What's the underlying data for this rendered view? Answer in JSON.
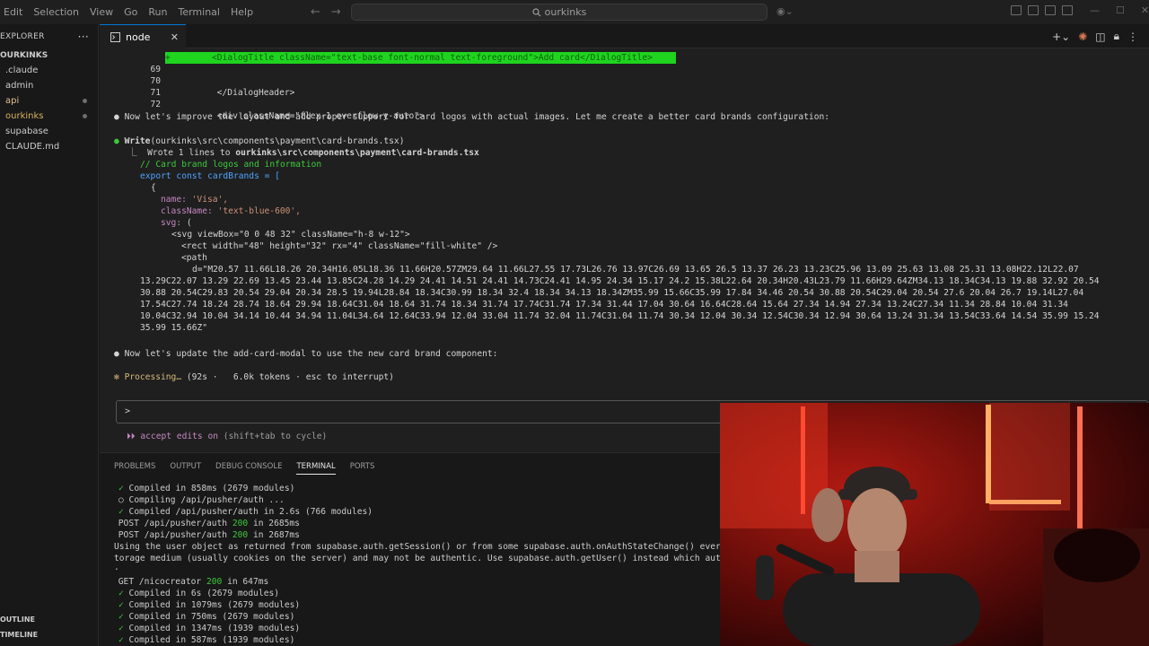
{
  "menu": [
    "Edit",
    "Selection",
    "View",
    "Go",
    "Run",
    "Terminal",
    "Help"
  ],
  "search": {
    "label": "ourkinks"
  },
  "sidebar": {
    "header": "EXPLORER",
    "root": "OURKINKS",
    "items": [
      ".claude",
      "admin",
      "api",
      "ourkinks",
      "supabase",
      "CLAUDE.md"
    ],
    "outline": "OUTLINE",
    "timeline": "TIMELINE"
  },
  "tab": {
    "label": "node",
    "close": "✕"
  },
  "code": {
    "l69_num": "69",
    "l69_prefix": "+",
    "l69_text": "        <DialogTitle className=\"text-base font-normal text-foreground\">Add card</DialogTitle>",
    "l70_num": "70",
    "l70_text": "          </DialogHeader>",
    "l71_num": "71",
    "l72_num": "72",
    "l72_text": "          <div className=\"flex-1 overflow-y-auto\">"
  },
  "messages": {
    "m1": "Now let's improve the layout and add proper support for card logos with actual images. Let me create a better card brands configuration:",
    "write_call": "Write",
    "write_arg": "(ourkinks\\src\\components\\payment\\card-brands.tsx)",
    "wrote_prefix": "⎿  Wrote 1 lines to ",
    "wrote_path": "ourkinks\\src\\components\\payment\\card-brands.tsx",
    "c1": "// Card brand logos and information",
    "c2": "export const cardBrands = [",
    "c3": "{",
    "c4_key": "name: ",
    "c4_val": "'Visa',",
    "c5_key": "className: ",
    "c5_val": "'text-blue-600',",
    "c6_key": "svg: ",
    "c6_val": "(",
    "c7": "<svg viewBox=\"0 0 48 32\" className=\"h-8 w-12\">",
    "c8": "<rect width=\"48\" height=\"32\" rx=\"4\" className=\"fill-white\" />",
    "c9": "<path",
    "c10": "d=\"M20.57 11.66L18.26 20.34H16.05L18.36 11.66H20.57ZM29.64 11.66L27.55 17.73L26.76 13.97C26.69 13.65 26.5 13.37 26.23 13.23C25.96 13.09 25.63 13.08 25.31 13.08H22.12L22.07",
    "c11": "13.29C22.07 13.29 22.69 13.45 23.44 13.85C24.28 14.29 24.41 14.51 24.41 14.73C24.41 14.95 24.34 15.17 24.2 15.38L22.64 20.34H20.43L23.79 11.66H29.64ZM34.13 18.34C34.13 19.88 32.92 20.54",
    "c12": "30.88 20.54C29.83 20.54 29.04 20.34 28.5 19.94L28.84 18.34C30.99 18.34 32.4 18.34 34.13 18.34ZM35.99 15.66C35.99 17.84 34.46 20.54 30.88 20.54C29.04 20.54 27.6 20.04 26.7 19.14L27.04",
    "c13": "17.54C27.74 18.24 28.74 18.64 29.94 18.64C31.04 18.64 31.74 18.34 31.74 17.74C31.74 17.34 31.44 17.04 30.64 16.64C28.64 15.64 27.34 14.94 27.34 13.24C27.34 11.34 28.84 10.04 31.34",
    "c14": "10.04C32.94 10.04 34.14 10.44 34.94 11.04L34.64 12.64C33.94 12.04 33.04 11.74 32.04 11.74C31.04 11.74 30.34 12.04 30.34 12.54C30.34 12.94 30.64 13.24 31.34 13.54C33.64 14.54 35.99 15.24",
    "c15": "35.99 15.66Z\"",
    "m2": "Now let's update the add-card-modal to use the new card brand component:",
    "proc_star": "✻ ",
    "proc_label": "Processing…",
    "proc_rest": " (92s ·   6.0k tokens · esc to interrupt)",
    "prompt": ">",
    "accept_arrows": "⏵⏵ ",
    "accept_label": "accept edits on",
    "accept_rest": " (shift+tab to cycle)"
  },
  "panel": {
    "tabs": [
      "PROBLEMS",
      "OUTPUT",
      "DEBUG CONSOLE",
      "TERMINAL",
      "PORTS"
    ],
    "active_tab": "TERMINAL"
  },
  "terminal": {
    "t1": " Compiled in 858ms (2679 modules)",
    "t2": " Compiling /api/pusher/auth ...",
    "t3": " Compiled /api/pusher/auth in 2.6s (766 modules)",
    "t4a": " POST /api/pusher/auth ",
    "t4b": "200",
    "t4c": " in 2685ms",
    "t5a": " POST /api/pusher/auth ",
    "t5b": "200",
    "t5c": " in 2687ms",
    "t6": "Using the user object as returned from supabase.auth.getSession() or from some supabase.auth.onAuthStateChange() ever",
    "t7": "torage medium (usually cookies on the server) and may not be authentic. Use supabase.auth.getUser() instead which aut",
    "t8": ".",
    "t9a": " GET /nicocreator ",
    "t9b": "200",
    "t9c": " in 647ms",
    "t10": " Compiled in 6s (2679 modules)",
    "t11": " Compiled in 1079ms (2679 modules)",
    "t12": " Compiled in 750ms (2679 modules)",
    "t13": " Compiled in 1347ms (1939 modules)",
    "t14": " Compiled in 587ms (1939 modules)"
  },
  "colors": {
    "accent": "#0078d4",
    "diff_added": "#1fd41f",
    "success": "#3dc93d"
  }
}
